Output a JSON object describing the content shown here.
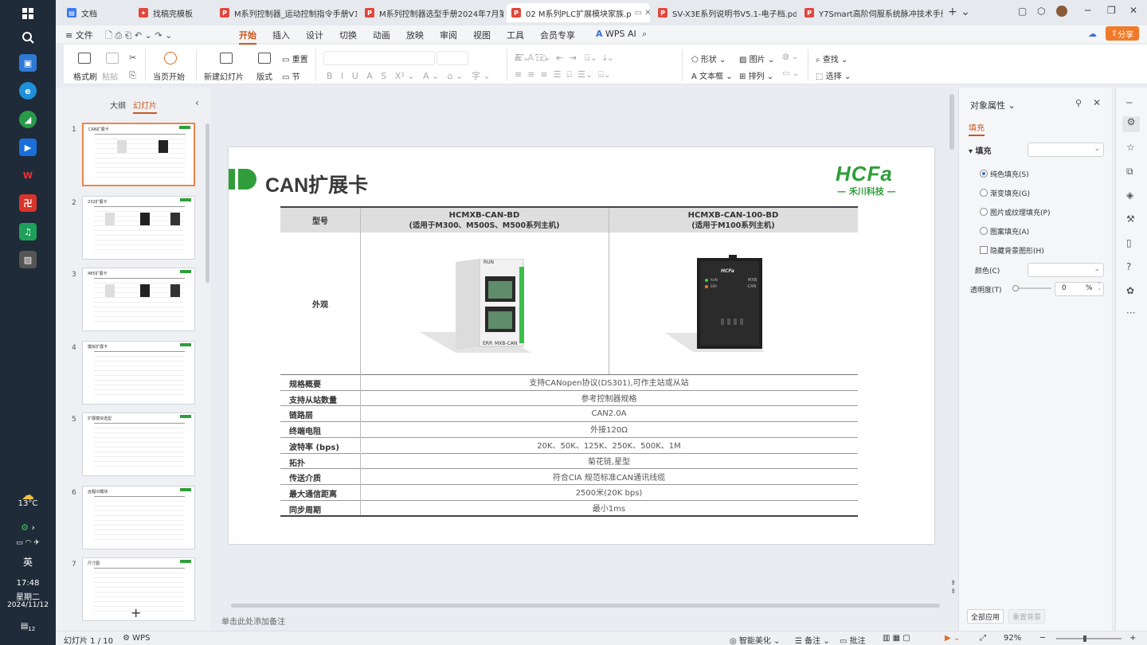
{
  "taskbar": {
    "weather": "13°C",
    "ime": "英",
    "time": "17:48",
    "weekday": "星期二",
    "date": "2024/11/12",
    "notif": "12"
  },
  "tabs": [
    {
      "label": "文档"
    },
    {
      "label": "找稿完模板"
    },
    {
      "label": "M系列控制器_运动控制指令手册V1.0"
    },
    {
      "label": "M系列控制器选型手册2024年7月第一"
    },
    {
      "label": "02 M系列PLC扩展模块家族.p"
    },
    {
      "label": "SV-X3E系列说明书V5.1-电子档.pdf"
    },
    {
      "label": "Y7Smart高阶伺服系统脉冲技术手册"
    }
  ],
  "menu": {
    "file": "文件",
    "items": [
      "开始",
      "插入",
      "设计",
      "切换",
      "动画",
      "放映",
      "审阅",
      "视图",
      "工具",
      "会员专享"
    ],
    "ai": "WPS AI",
    "share": "分享"
  },
  "ribbon": {
    "format_painter": "格式刷",
    "paste": "粘贴",
    "slideshow": "当页开始",
    "new_slide": "新建幻灯片",
    "layout": "版式",
    "reset": "重置",
    "section": "节",
    "shape": "形状",
    "picture": "图片",
    "textbox": "文本框",
    "arrange": "排列",
    "find": "查找",
    "select": "选择"
  },
  "leftpane": {
    "tab_outline": "大纲",
    "tab_slides": "幻灯片",
    "thumbs": [
      {
        "num": "1",
        "title": "CAN扩展卡"
      },
      {
        "num": "2",
        "title": "232扩展卡"
      },
      {
        "num": "3",
        "title": "485扩展卡"
      },
      {
        "num": "4",
        "title": "模拟扩展卡"
      },
      {
        "num": "5",
        "title": "扩展模块选型"
      },
      {
        "num": "6",
        "title": "远程IO模块"
      },
      {
        "num": "7",
        "title": "尺寸图"
      }
    ],
    "add": "+"
  },
  "slide": {
    "title": "CAN扩展卡",
    "logo": "HCFa",
    "logo_sub": "— 禾川科技 —",
    "headers": {
      "model": "型号",
      "col1_title": "HCMXB-CAN-BD",
      "col1_sub": "(适用于M300、M500S、M500系列主机)",
      "col2_title": "HCMXB-CAN-100-BD",
      "col2_sub": "(适用于M100系列主机)"
    },
    "appearance": "外观",
    "img1_run": "RUN",
    "img1_err": "ERR",
    "img1_model": "MXB-CAN",
    "img2_logo": "HCFa",
    "img2_run": "RUN",
    "img2_err": "ERR",
    "img2_mxb": "MXB",
    "img2_can": "-CAN",
    "rows": [
      {
        "label": "规格概要",
        "value": "支持CANopen协议(DS301),可作主站或从站"
      },
      {
        "label": "支持从站数量",
        "value": "参考控制器规格"
      },
      {
        "label": "链路层",
        "value": "CAN2.0A"
      },
      {
        "label": "终端电阻",
        "value": "外接120Ω"
      },
      {
        "label": "波特率 (bps)",
        "value": "20K、50K、125K、250K、500K、1M"
      },
      {
        "label": "拓扑",
        "value": "菊花链,星型"
      },
      {
        "label": "传送介质",
        "value": "符合CIA 规范标准CAN通讯线缆"
      },
      {
        "label": "最大通信距离",
        "value": "2500米(20K bps)"
      },
      {
        "label": "同步周期",
        "value": "最小1ms"
      }
    ]
  },
  "notes_placeholder": "单击此处添加备注",
  "rightpane": {
    "title": "对象属性",
    "tab": "填充",
    "section": "填充",
    "options": [
      "纯色填充(S)",
      "渐变填充(G)",
      "图片或纹理填充(P)",
      "图案填充(A)"
    ],
    "checkbox": "隐藏背景图形(H)",
    "color_label": "颜色(C)",
    "transparency_label": "透明度(T)",
    "transparency_value": "0",
    "transparency_unit": "%",
    "apply_all": "全部应用",
    "reset_bg": "重置背景"
  },
  "statusbar": {
    "slide_info": "幻灯片 1 / 10",
    "wps": "WPS",
    "beautify": "智能美化",
    "notes": "备注",
    "comments": "批注",
    "zoom": "92%"
  },
  "colors": {
    "accent": "#c9571e",
    "brand_green": "#2f9e3a",
    "selection": "#e8874d"
  }
}
